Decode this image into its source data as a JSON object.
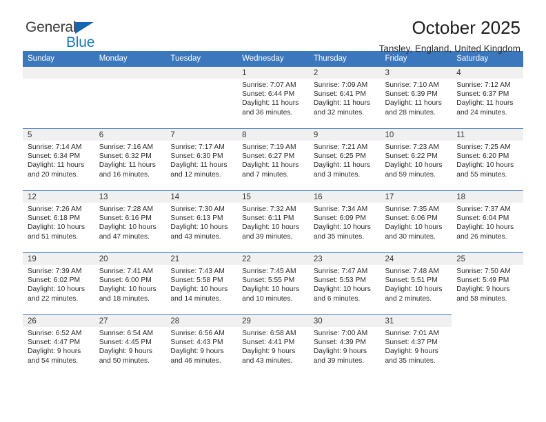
{
  "brand": {
    "line1": "General",
    "line2": "Blue",
    "triangle_color": "#1565b5",
    "text_color": "#3b3b3b",
    "blue_text_color": "#1478cf"
  },
  "header": {
    "title": "October 2025",
    "location": "Tansley, England, United Kingdom"
  },
  "theme": {
    "header_row_background": "#3b77bc",
    "header_row_text": "#ffffff",
    "daynum_background": "#f0f0f0",
    "cell_border": "#4a7ebb"
  },
  "weekday_headers": [
    "Sunday",
    "Monday",
    "Tuesday",
    "Wednesday",
    "Thursday",
    "Friday",
    "Saturday"
  ],
  "weeks": [
    [
      {
        "blank": false,
        "empty": true,
        "day": "",
        "sunrise": "",
        "sunset": "",
        "daylight_line1": "",
        "daylight_line2": ""
      },
      {
        "blank": false,
        "empty": true,
        "day": "",
        "sunrise": "",
        "sunset": "",
        "daylight_line1": "",
        "daylight_line2": ""
      },
      {
        "blank": false,
        "empty": true,
        "day": "",
        "sunrise": "",
        "sunset": "",
        "daylight_line1": "",
        "daylight_line2": ""
      },
      {
        "blank": false,
        "empty": false,
        "day": "1",
        "sunrise": "Sunrise: 7:07 AM",
        "sunset": "Sunset: 6:44 PM",
        "daylight_line1": "Daylight: 11 hours",
        "daylight_line2": "and 36 minutes."
      },
      {
        "blank": false,
        "empty": false,
        "day": "2",
        "sunrise": "Sunrise: 7:09 AM",
        "sunset": "Sunset: 6:41 PM",
        "daylight_line1": "Daylight: 11 hours",
        "daylight_line2": "and 32 minutes."
      },
      {
        "blank": false,
        "empty": false,
        "day": "3",
        "sunrise": "Sunrise: 7:10 AM",
        "sunset": "Sunset: 6:39 PM",
        "daylight_line1": "Daylight: 11 hours",
        "daylight_line2": "and 28 minutes."
      },
      {
        "blank": false,
        "empty": false,
        "day": "4",
        "sunrise": "Sunrise: 7:12 AM",
        "sunset": "Sunset: 6:37 PM",
        "daylight_line1": "Daylight: 11 hours",
        "daylight_line2": "and 24 minutes."
      }
    ],
    [
      {
        "blank": false,
        "empty": false,
        "day": "5",
        "sunrise": "Sunrise: 7:14 AM",
        "sunset": "Sunset: 6:34 PM",
        "daylight_line1": "Daylight: 11 hours",
        "daylight_line2": "and 20 minutes."
      },
      {
        "blank": false,
        "empty": false,
        "day": "6",
        "sunrise": "Sunrise: 7:16 AM",
        "sunset": "Sunset: 6:32 PM",
        "daylight_line1": "Daylight: 11 hours",
        "daylight_line2": "and 16 minutes."
      },
      {
        "blank": false,
        "empty": false,
        "day": "7",
        "sunrise": "Sunrise: 7:17 AM",
        "sunset": "Sunset: 6:30 PM",
        "daylight_line1": "Daylight: 11 hours",
        "daylight_line2": "and 12 minutes."
      },
      {
        "blank": false,
        "empty": false,
        "day": "8",
        "sunrise": "Sunrise: 7:19 AM",
        "sunset": "Sunset: 6:27 PM",
        "daylight_line1": "Daylight: 11 hours",
        "daylight_line2": "and 7 minutes."
      },
      {
        "blank": false,
        "empty": false,
        "day": "9",
        "sunrise": "Sunrise: 7:21 AM",
        "sunset": "Sunset: 6:25 PM",
        "daylight_line1": "Daylight: 11 hours",
        "daylight_line2": "and 3 minutes."
      },
      {
        "blank": false,
        "empty": false,
        "day": "10",
        "sunrise": "Sunrise: 7:23 AM",
        "sunset": "Sunset: 6:22 PM",
        "daylight_line1": "Daylight: 10 hours",
        "daylight_line2": "and 59 minutes."
      },
      {
        "blank": false,
        "empty": false,
        "day": "11",
        "sunrise": "Sunrise: 7:25 AM",
        "sunset": "Sunset: 6:20 PM",
        "daylight_line1": "Daylight: 10 hours",
        "daylight_line2": "and 55 minutes."
      }
    ],
    [
      {
        "blank": false,
        "empty": false,
        "day": "12",
        "sunrise": "Sunrise: 7:26 AM",
        "sunset": "Sunset: 6:18 PM",
        "daylight_line1": "Daylight: 10 hours",
        "daylight_line2": "and 51 minutes."
      },
      {
        "blank": false,
        "empty": false,
        "day": "13",
        "sunrise": "Sunrise: 7:28 AM",
        "sunset": "Sunset: 6:16 PM",
        "daylight_line1": "Daylight: 10 hours",
        "daylight_line2": "and 47 minutes."
      },
      {
        "blank": false,
        "empty": false,
        "day": "14",
        "sunrise": "Sunrise: 7:30 AM",
        "sunset": "Sunset: 6:13 PM",
        "daylight_line1": "Daylight: 10 hours",
        "daylight_line2": "and 43 minutes."
      },
      {
        "blank": false,
        "empty": false,
        "day": "15",
        "sunrise": "Sunrise: 7:32 AM",
        "sunset": "Sunset: 6:11 PM",
        "daylight_line1": "Daylight: 10 hours",
        "daylight_line2": "and 39 minutes."
      },
      {
        "blank": false,
        "empty": false,
        "day": "16",
        "sunrise": "Sunrise: 7:34 AM",
        "sunset": "Sunset: 6:09 PM",
        "daylight_line1": "Daylight: 10 hours",
        "daylight_line2": "and 35 minutes."
      },
      {
        "blank": false,
        "empty": false,
        "day": "17",
        "sunrise": "Sunrise: 7:35 AM",
        "sunset": "Sunset: 6:06 PM",
        "daylight_line1": "Daylight: 10 hours",
        "daylight_line2": "and 30 minutes."
      },
      {
        "blank": false,
        "empty": false,
        "day": "18",
        "sunrise": "Sunrise: 7:37 AM",
        "sunset": "Sunset: 6:04 PM",
        "daylight_line1": "Daylight: 10 hours",
        "daylight_line2": "and 26 minutes."
      }
    ],
    [
      {
        "blank": false,
        "empty": false,
        "day": "19",
        "sunrise": "Sunrise: 7:39 AM",
        "sunset": "Sunset: 6:02 PM",
        "daylight_line1": "Daylight: 10 hours",
        "daylight_line2": "and 22 minutes."
      },
      {
        "blank": false,
        "empty": false,
        "day": "20",
        "sunrise": "Sunrise: 7:41 AM",
        "sunset": "Sunset: 6:00 PM",
        "daylight_line1": "Daylight: 10 hours",
        "daylight_line2": "and 18 minutes."
      },
      {
        "blank": false,
        "empty": false,
        "day": "21",
        "sunrise": "Sunrise: 7:43 AM",
        "sunset": "Sunset: 5:58 PM",
        "daylight_line1": "Daylight: 10 hours",
        "daylight_line2": "and 14 minutes."
      },
      {
        "blank": false,
        "empty": false,
        "day": "22",
        "sunrise": "Sunrise: 7:45 AM",
        "sunset": "Sunset: 5:55 PM",
        "daylight_line1": "Daylight: 10 hours",
        "daylight_line2": "and 10 minutes."
      },
      {
        "blank": false,
        "empty": false,
        "day": "23",
        "sunrise": "Sunrise: 7:47 AM",
        "sunset": "Sunset: 5:53 PM",
        "daylight_line1": "Daylight: 10 hours",
        "daylight_line2": "and 6 minutes."
      },
      {
        "blank": false,
        "empty": false,
        "day": "24",
        "sunrise": "Sunrise: 7:48 AM",
        "sunset": "Sunset: 5:51 PM",
        "daylight_line1": "Daylight: 10 hours",
        "daylight_line2": "and 2 minutes."
      },
      {
        "blank": false,
        "empty": false,
        "day": "25",
        "sunrise": "Sunrise: 7:50 AM",
        "sunset": "Sunset: 5:49 PM",
        "daylight_line1": "Daylight: 9 hours",
        "daylight_line2": "and 58 minutes."
      }
    ],
    [
      {
        "blank": false,
        "empty": false,
        "day": "26",
        "sunrise": "Sunrise: 6:52 AM",
        "sunset": "Sunset: 4:47 PM",
        "daylight_line1": "Daylight: 9 hours",
        "daylight_line2": "and 54 minutes."
      },
      {
        "blank": false,
        "empty": false,
        "day": "27",
        "sunrise": "Sunrise: 6:54 AM",
        "sunset": "Sunset: 4:45 PM",
        "daylight_line1": "Daylight: 9 hours",
        "daylight_line2": "and 50 minutes."
      },
      {
        "blank": false,
        "empty": false,
        "day": "28",
        "sunrise": "Sunrise: 6:56 AM",
        "sunset": "Sunset: 4:43 PM",
        "daylight_line1": "Daylight: 9 hours",
        "daylight_line2": "and 46 minutes."
      },
      {
        "blank": false,
        "empty": false,
        "day": "29",
        "sunrise": "Sunrise: 6:58 AM",
        "sunset": "Sunset: 4:41 PM",
        "daylight_line1": "Daylight: 9 hours",
        "daylight_line2": "and 43 minutes."
      },
      {
        "blank": false,
        "empty": false,
        "day": "30",
        "sunrise": "Sunrise: 7:00 AM",
        "sunset": "Sunset: 4:39 PM",
        "daylight_line1": "Daylight: 9 hours",
        "daylight_line2": "and 39 minutes."
      },
      {
        "blank": false,
        "empty": false,
        "day": "31",
        "sunrise": "Sunrise: 7:01 AM",
        "sunset": "Sunset: 4:37 PM",
        "daylight_line1": "Daylight: 9 hours",
        "daylight_line2": "and 35 minutes."
      },
      {
        "blank": true,
        "empty": true,
        "day": "",
        "sunrise": "",
        "sunset": "",
        "daylight_line1": "",
        "daylight_line2": ""
      }
    ]
  ]
}
